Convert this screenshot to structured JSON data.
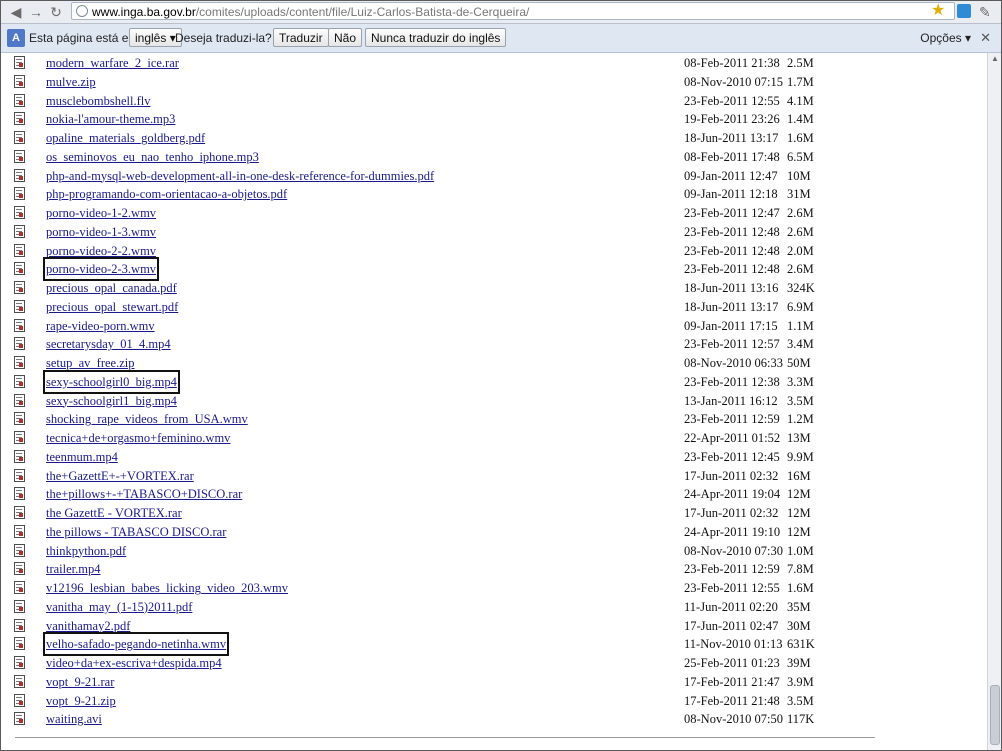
{
  "browser": {
    "url_host": "www.inga.ba.gov.br",
    "url_path": "/comites/uploads/content/file/Luiz-Carlos-Batista-de-Cerqueira/"
  },
  "translate_bar": {
    "prefix": "Esta página está em",
    "language": "inglês",
    "question": "Deseja traduzi-la?",
    "translate_btn": "Traduzir",
    "no_btn": "Não",
    "never_btn": "Nunca traduzir do inglês",
    "options": "Opções"
  },
  "files": [
    {
      "name": "modern_warfare_2_ice.rar",
      "date": "08-Feb-2011 21:38",
      "size": "2.5M"
    },
    {
      "name": "mulve.zip",
      "date": "08-Nov-2010 07:15",
      "size": "1.7M"
    },
    {
      "name": "musclebombshell.flv",
      "date": "23-Feb-2011 12:55",
      "size": "4.1M"
    },
    {
      "name": "nokia-l'amour-theme.mp3",
      "date": "19-Feb-2011 23:26",
      "size": "1.4M"
    },
    {
      "name": "opaline_materials_goldberg.pdf",
      "date": "18-Jun-2011 13:17",
      "size": "1.6M"
    },
    {
      "name": "os_seminovos_eu_nao_tenho_iphone.mp3",
      "date": "08-Feb-2011 17:48",
      "size": "6.5M"
    },
    {
      "name": "php-and-mysql-web-development-all-in-one-desk-reference-for-dummies.pdf",
      "date": "09-Jan-2011 12:47",
      "size": "10M"
    },
    {
      "name": "php-programando-com-orientacao-a-objetos.pdf",
      "date": "09-Jan-2011 12:18",
      "size": "31M"
    },
    {
      "name": "porno-video-1-2.wmv",
      "date": "23-Feb-2011 12:47",
      "size": "2.6M"
    },
    {
      "name": "porno-video-1-3.wmv",
      "date": "23-Feb-2011 12:48",
      "size": "2.6M"
    },
    {
      "name": "porno-video-2-2.wmv",
      "date": "23-Feb-2011 12:48",
      "size": "2.0M"
    },
    {
      "name": "porno-video-2-3.wmv",
      "date": "23-Feb-2011 12:48",
      "size": "2.6M",
      "boxed": true
    },
    {
      "name": "precious_opal_canada.pdf",
      "date": "18-Jun-2011 13:16",
      "size": "324K"
    },
    {
      "name": "precious_opal_stewart.pdf",
      "date": "18-Jun-2011 13:17",
      "size": "6.9M"
    },
    {
      "name": "rape-video-porn.wmv",
      "date": "09-Jan-2011 17:15",
      "size": "1.1M"
    },
    {
      "name": "secretarysday_01_4.mp4",
      "date": "23-Feb-2011 12:57",
      "size": "3.4M"
    },
    {
      "name": "setup_av_free.zip",
      "date": "08-Nov-2010 06:33",
      "size": "50M"
    },
    {
      "name": "sexy-schoolgirl0_big.mp4",
      "date": "23-Feb-2011 12:38",
      "size": "3.3M",
      "boxed": true
    },
    {
      "name": "sexy-schoolgirl1_big.mp4",
      "date": "13-Jan-2011 16:12",
      "size": "3.5M"
    },
    {
      "name": "shocking_rape_videos_from_USA.wmv",
      "date": "23-Feb-2011 12:59",
      "size": "1.2M"
    },
    {
      "name": "tecnica+de+orgasmo+feminino.wmv",
      "date": "22-Apr-2011 01:52",
      "size": "13M"
    },
    {
      "name": "teenmum.mp4",
      "date": "23-Feb-2011 12:45",
      "size": "9.9M"
    },
    {
      "name": "the+GazettE+-+VORTEX.rar",
      "date": "17-Jun-2011 02:32",
      "size": "16M"
    },
    {
      "name": "the+pillows+-+TABASCO+DISCO.rar",
      "date": "24-Apr-2011 19:04",
      "size": "12M"
    },
    {
      "name": "the GazettE - VORTEX.rar",
      "date": "17-Jun-2011 02:32",
      "size": "12M"
    },
    {
      "name": "the pillows - TABASCO DISCO.rar",
      "date": "24-Apr-2011 19:10",
      "size": "12M"
    },
    {
      "name": "thinkpython.pdf",
      "date": "08-Nov-2010 07:30",
      "size": "1.0M"
    },
    {
      "name": "trailer.mp4",
      "date": "23-Feb-2011 12:59",
      "size": "7.8M"
    },
    {
      "name": "v12196_lesbian_babes_licking_video_203.wmv",
      "date": "23-Feb-2011 12:55",
      "size": "1.6M"
    },
    {
      "name": "vanitha_may_(1-15)2011.pdf",
      "date": "11-Jun-2011 02:20",
      "size": "35M"
    },
    {
      "name": "vanithamay2.pdf",
      "date": "17-Jun-2011 02:47",
      "size": "30M"
    },
    {
      "name": "velho-safado-pegando-netinha.wmv",
      "date": "11-Nov-2010 01:13",
      "size": "631K",
      "boxed": true
    },
    {
      "name": "video+da+ex-escriva+despida.mp4",
      "date": "25-Feb-2011 01:23",
      "size": "39M"
    },
    {
      "name": "vopt_9-21.rar",
      "date": "17-Feb-2011 21:47",
      "size": "3.9M"
    },
    {
      "name": "vopt_9-21.zip",
      "date": "17-Feb-2011 21:48",
      "size": "3.5M"
    },
    {
      "name": "waiting.avi",
      "date": "08-Nov-2010 07:50",
      "size": "117K"
    }
  ]
}
